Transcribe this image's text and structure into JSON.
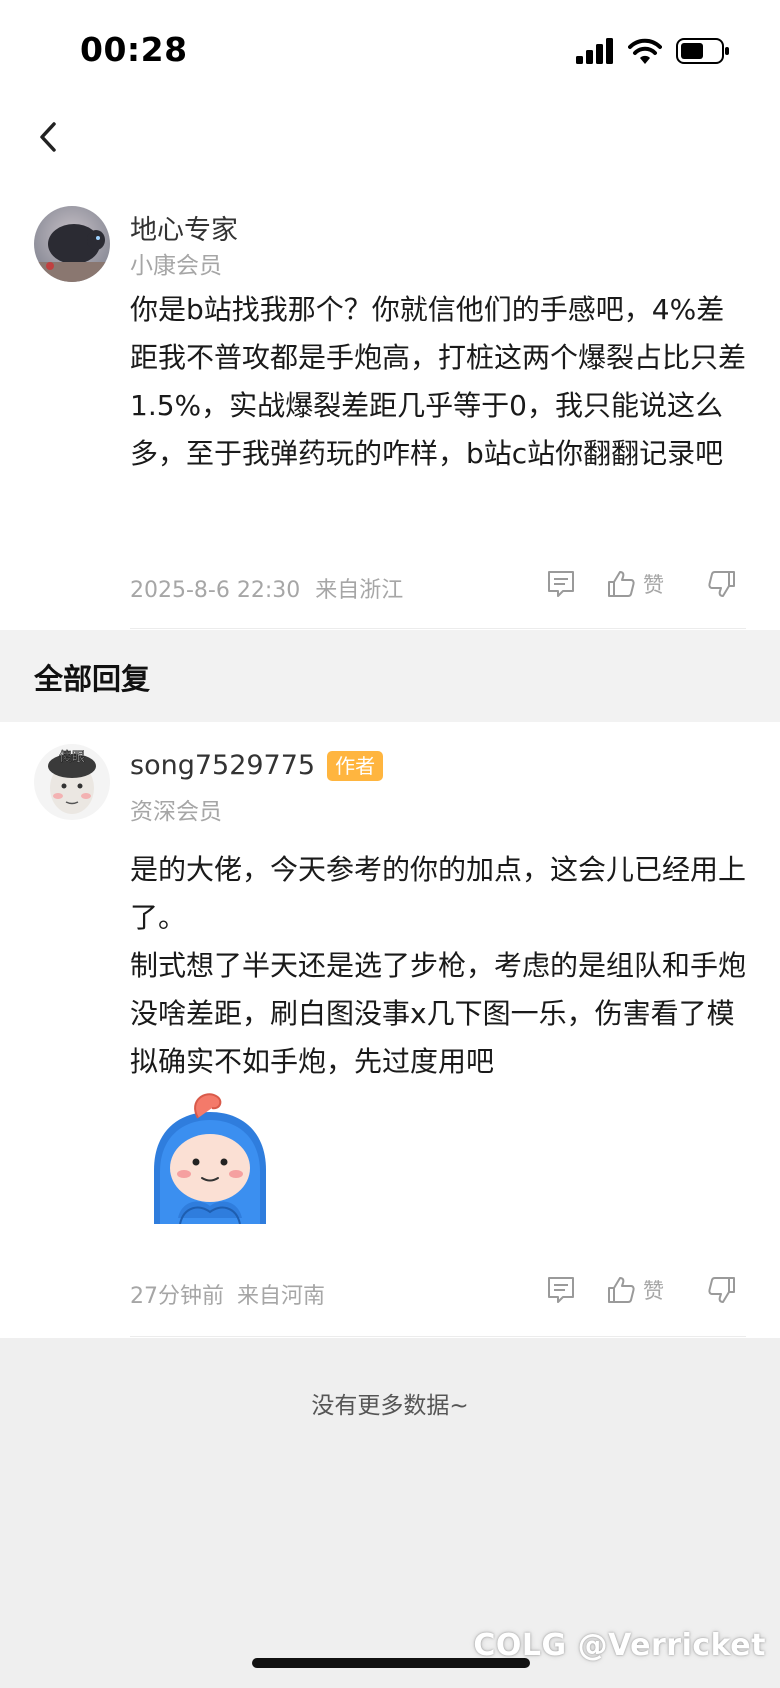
{
  "status_bar": {
    "time": "00:28"
  },
  "main_post": {
    "author": "地心专家",
    "member_level": "小康会员",
    "content": "你是b站找我那个？你就信他们的手感吧，4%差距我不普攻都是手炮高，打桩这两个爆裂占比只差1.5%，实战爆裂差距几乎等于0，我只能说这么多，至于我弹药玩的咋样，b站c站你翻翻记录吧",
    "timestamp": "2025-8-6 22:30",
    "location": "来自浙江",
    "like_label": "赞"
  },
  "section": {
    "title": "全部回复"
  },
  "reply": {
    "author": "song7529775",
    "badge": "作者",
    "avatar_text": "傻眼",
    "member_level": "资深会员",
    "content": "是的大佬，今天参考的你的加点，这会儿已经用上了。\n制式想了半天还是选了步枪，考虑的是组队和手炮没啥差距，刷白图没事x几下图一乐，伤害看了模拟确实不如手炮，先过度用吧",
    "timestamp": "27分钟前",
    "location": "来自河南",
    "like_label": "赞"
  },
  "footer": {
    "no_more": "没有更多数据~",
    "watermark": "COLG @Verricket"
  },
  "colors": {
    "badge": "#ffb53f",
    "section_bg": "#f2f2f2",
    "footer_bg": "#efefef"
  }
}
